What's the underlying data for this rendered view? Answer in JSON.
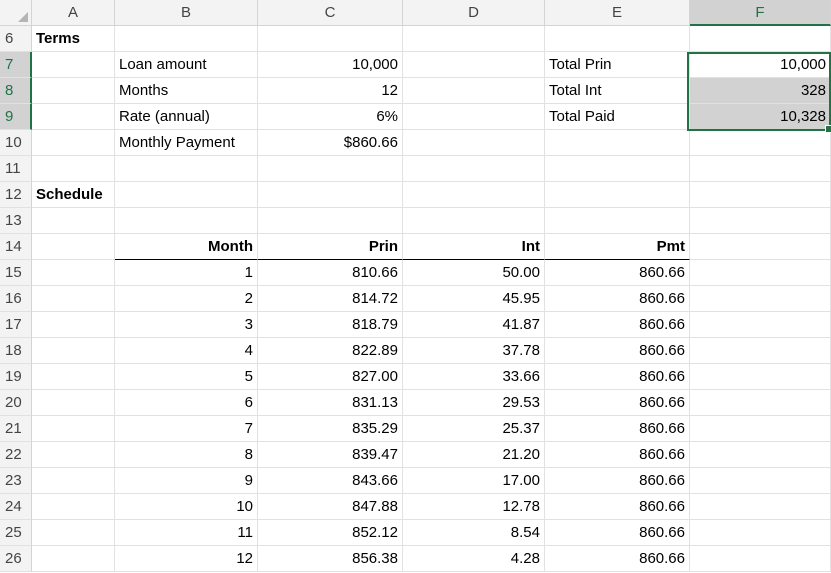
{
  "columns": [
    "A",
    "B",
    "C",
    "D",
    "E",
    "F"
  ],
  "rows": [
    "6",
    "7",
    "8",
    "9",
    "10",
    "11",
    "12",
    "13",
    "14",
    "15",
    "16",
    "17",
    "18",
    "19",
    "20",
    "21",
    "22",
    "23",
    "24",
    "25",
    "26"
  ],
  "terms": {
    "title": "Terms",
    "loan_amount_label": "Loan amount",
    "loan_amount": "10,000",
    "months_label": "Months",
    "months": "12",
    "rate_label": "Rate (annual)",
    "rate": "6%",
    "payment_label": "Monthly Payment",
    "payment": "$860.66"
  },
  "totals": {
    "prin_label": "Total Prin",
    "prin": "10,000",
    "int_label": "Total Int",
    "int": "328",
    "paid_label": "Total Paid",
    "paid": "10,328"
  },
  "schedule": {
    "title": "Schedule",
    "headers": [
      "Month",
      "Prin",
      "Int",
      "Pmt"
    ],
    "rows": [
      [
        "1",
        "810.66",
        "50.00",
        "860.66"
      ],
      [
        "2",
        "814.72",
        "45.95",
        "860.66"
      ],
      [
        "3",
        "818.79",
        "41.87",
        "860.66"
      ],
      [
        "4",
        "822.89",
        "37.78",
        "860.66"
      ],
      [
        "5",
        "827.00",
        "33.66",
        "860.66"
      ],
      [
        "6",
        "831.13",
        "29.53",
        "860.66"
      ],
      [
        "7",
        "835.29",
        "25.37",
        "860.66"
      ],
      [
        "8",
        "839.47",
        "21.20",
        "860.66"
      ],
      [
        "9",
        "843.66",
        "17.00",
        "860.66"
      ],
      [
        "10",
        "847.88",
        "12.78",
        "860.66"
      ],
      [
        "11",
        "852.12",
        "8.54",
        "860.66"
      ],
      [
        "12",
        "856.38",
        "4.28",
        "860.66"
      ]
    ]
  },
  "colors": {
    "accent": "#217346",
    "selection_fill": "#d2d2d2",
    "header_bg": "#f3f3f3",
    "gridline": "#e1e1e1"
  }
}
